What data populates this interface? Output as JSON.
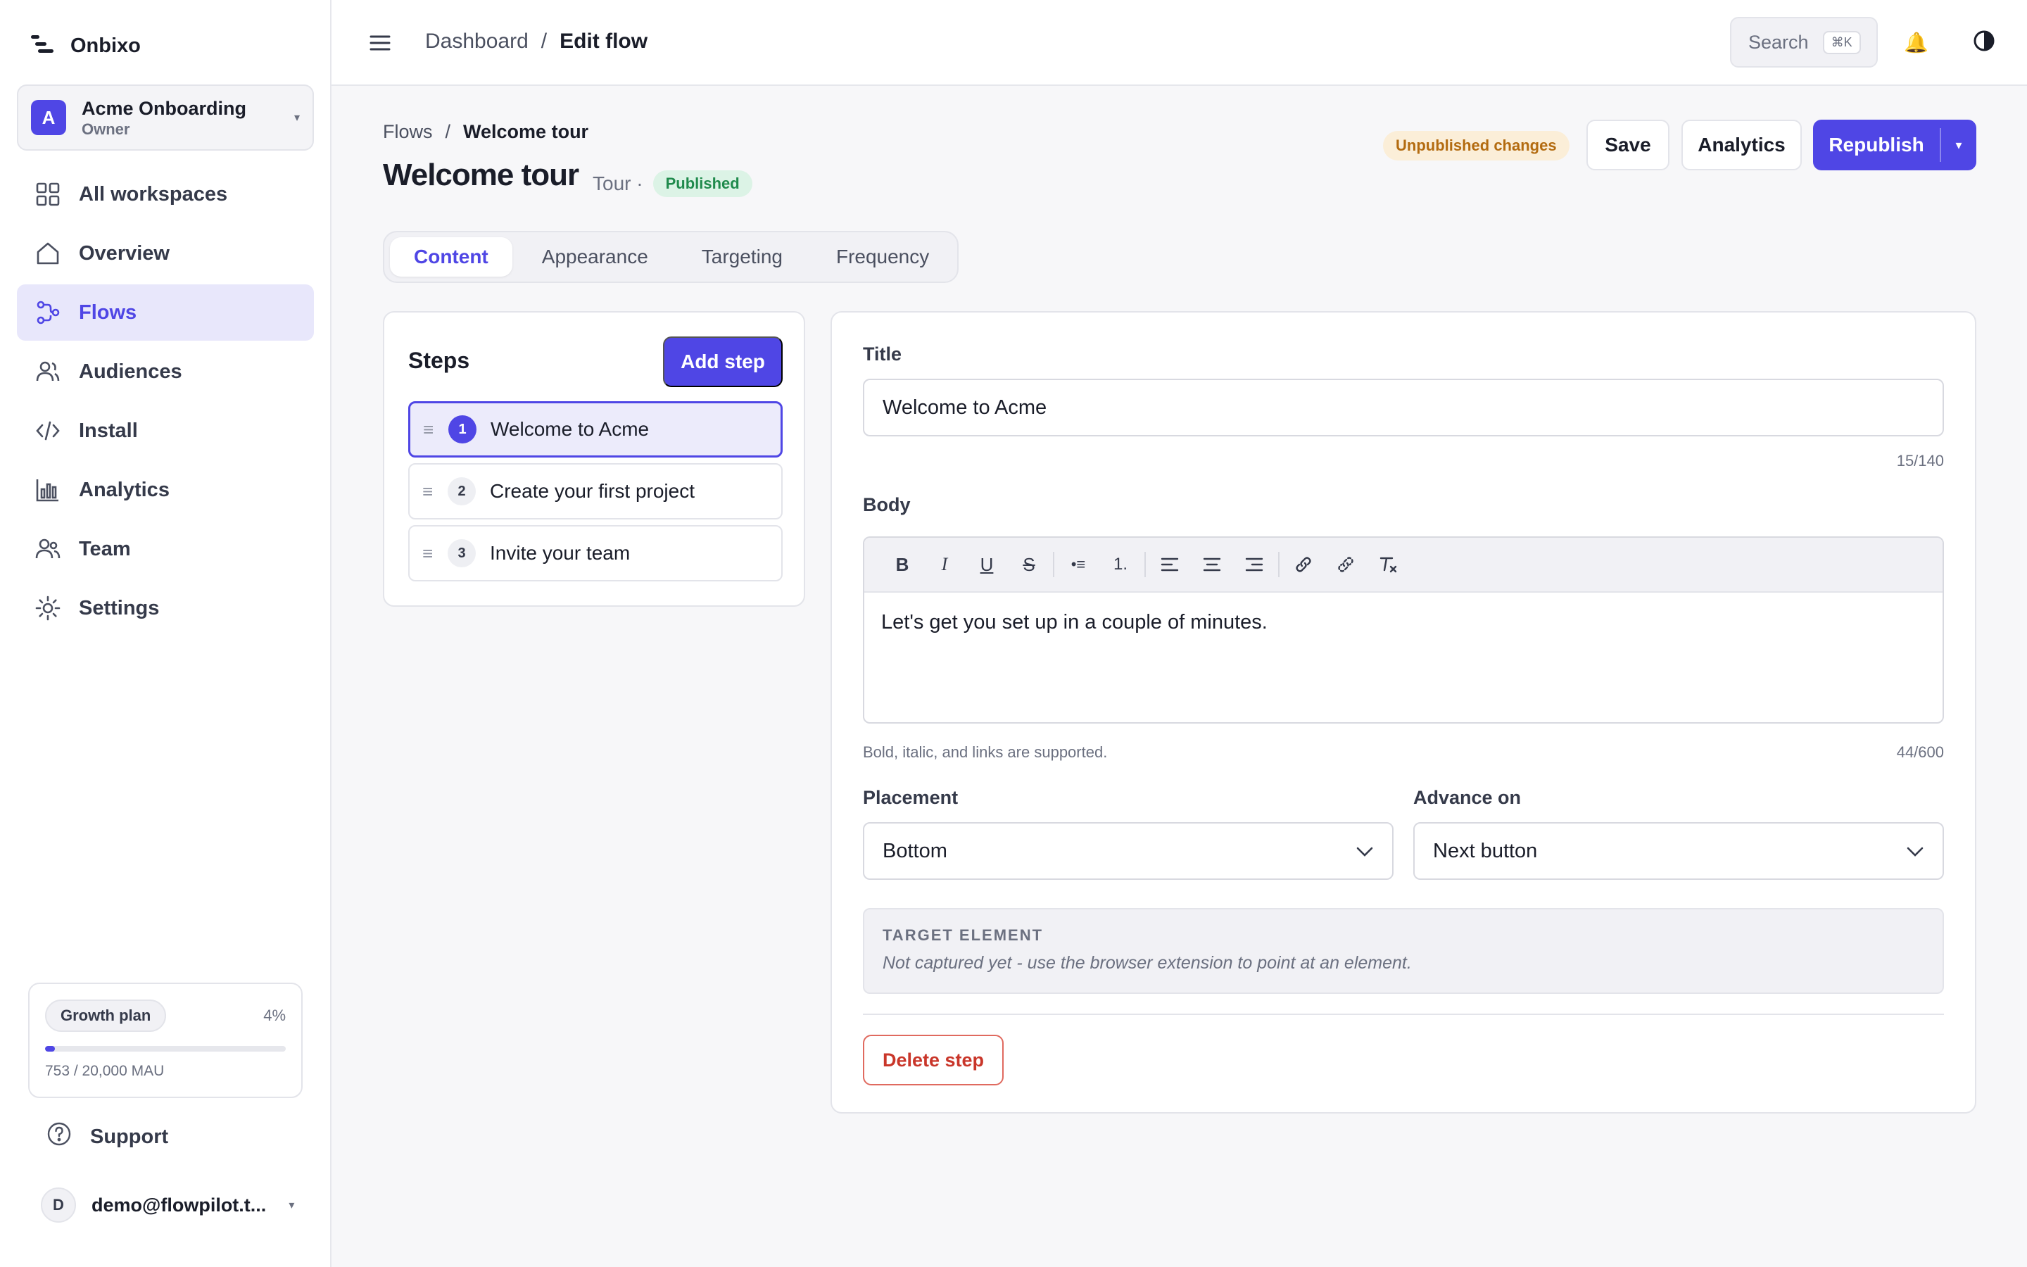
{
  "brand": {
    "name": "Onbixo",
    "icon": "onbixo-logo-icon"
  },
  "workspace": {
    "initial": "A",
    "name": "Acme Onboarding",
    "role": "Owner",
    "caret": "▾"
  },
  "sidebar": {
    "items": [
      {
        "label": "All workspaces",
        "icon": "grid-icon"
      },
      {
        "label": "Overview",
        "icon": "home-icon"
      },
      {
        "label": "Flows",
        "icon": "flows-icon",
        "active": true
      },
      {
        "label": "Audiences",
        "icon": "users-icon"
      },
      {
        "label": "Install",
        "icon": "code-icon"
      },
      {
        "label": "Analytics",
        "icon": "bar-chart-icon"
      },
      {
        "label": "Team",
        "icon": "team-icon"
      },
      {
        "label": "Settings",
        "icon": "gear-icon"
      }
    ],
    "plan": {
      "name": "Growth plan",
      "percent_label": "4%",
      "usage_fraction": 0.04,
      "mau": "753 / 20,000 MAU"
    },
    "support": {
      "label": "Support",
      "icon": "help-circle-icon"
    },
    "user": {
      "initial": "D",
      "email": "demo@flowpilot.t...",
      "caret": "▾"
    }
  },
  "topbar": {
    "breadcrumb": {
      "root": "Dashboard",
      "sep": "/",
      "current": "Edit flow"
    },
    "search": {
      "label": "Search",
      "shortcut": "⌘K"
    },
    "bell": "🔔"
  },
  "header": {
    "breadcrumb": {
      "root": "Flows",
      "sep": "/",
      "current": "Welcome tour"
    },
    "title": "Welcome tour",
    "type": "Tour ·",
    "status": "Published",
    "unpublished_badge": "Unpublished changes",
    "save_label": "Save",
    "analytics_label": "Analytics",
    "republish_label": "Republish",
    "republish_caret": "▾"
  },
  "tabs": [
    {
      "label": "Content",
      "active": true
    },
    {
      "label": "Appearance"
    },
    {
      "label": "Targeting"
    },
    {
      "label": "Frequency"
    }
  ],
  "steps": {
    "title": "Steps",
    "add_label": "Add step",
    "drag_handle": "≡",
    "items": [
      {
        "num": "1",
        "label": "Welcome to Acme",
        "active": true
      },
      {
        "num": "2",
        "label": "Create your first project"
      },
      {
        "num": "3",
        "label": "Invite your team"
      }
    ]
  },
  "editor": {
    "title_label": "Title",
    "title_value": "Welcome to Acme",
    "title_counter": "15/140",
    "body_label": "Body",
    "toolbar": {
      "bold": "B",
      "italic": "I",
      "underline": "U",
      "strike": "S",
      "bullet": "•≡",
      "numbered": "1."
    },
    "body_value": "Let's get you set up in a couple of minutes.",
    "body_help": "Bold, italic, and links are supported.",
    "body_counter": "44/600",
    "placement_label": "Placement",
    "placement_value": "Bottom",
    "advance_label": "Advance on",
    "advance_value": "Next button",
    "target_label": "TARGET ELEMENT",
    "target_desc": "Not captured yet - use the browser extension to point at an element.",
    "delete_label": "Delete step"
  },
  "colors": {
    "accent": "#4f46e5",
    "published": "#1f8a4c",
    "unpublished": "#b36b10",
    "danger": "#c9362a"
  }
}
